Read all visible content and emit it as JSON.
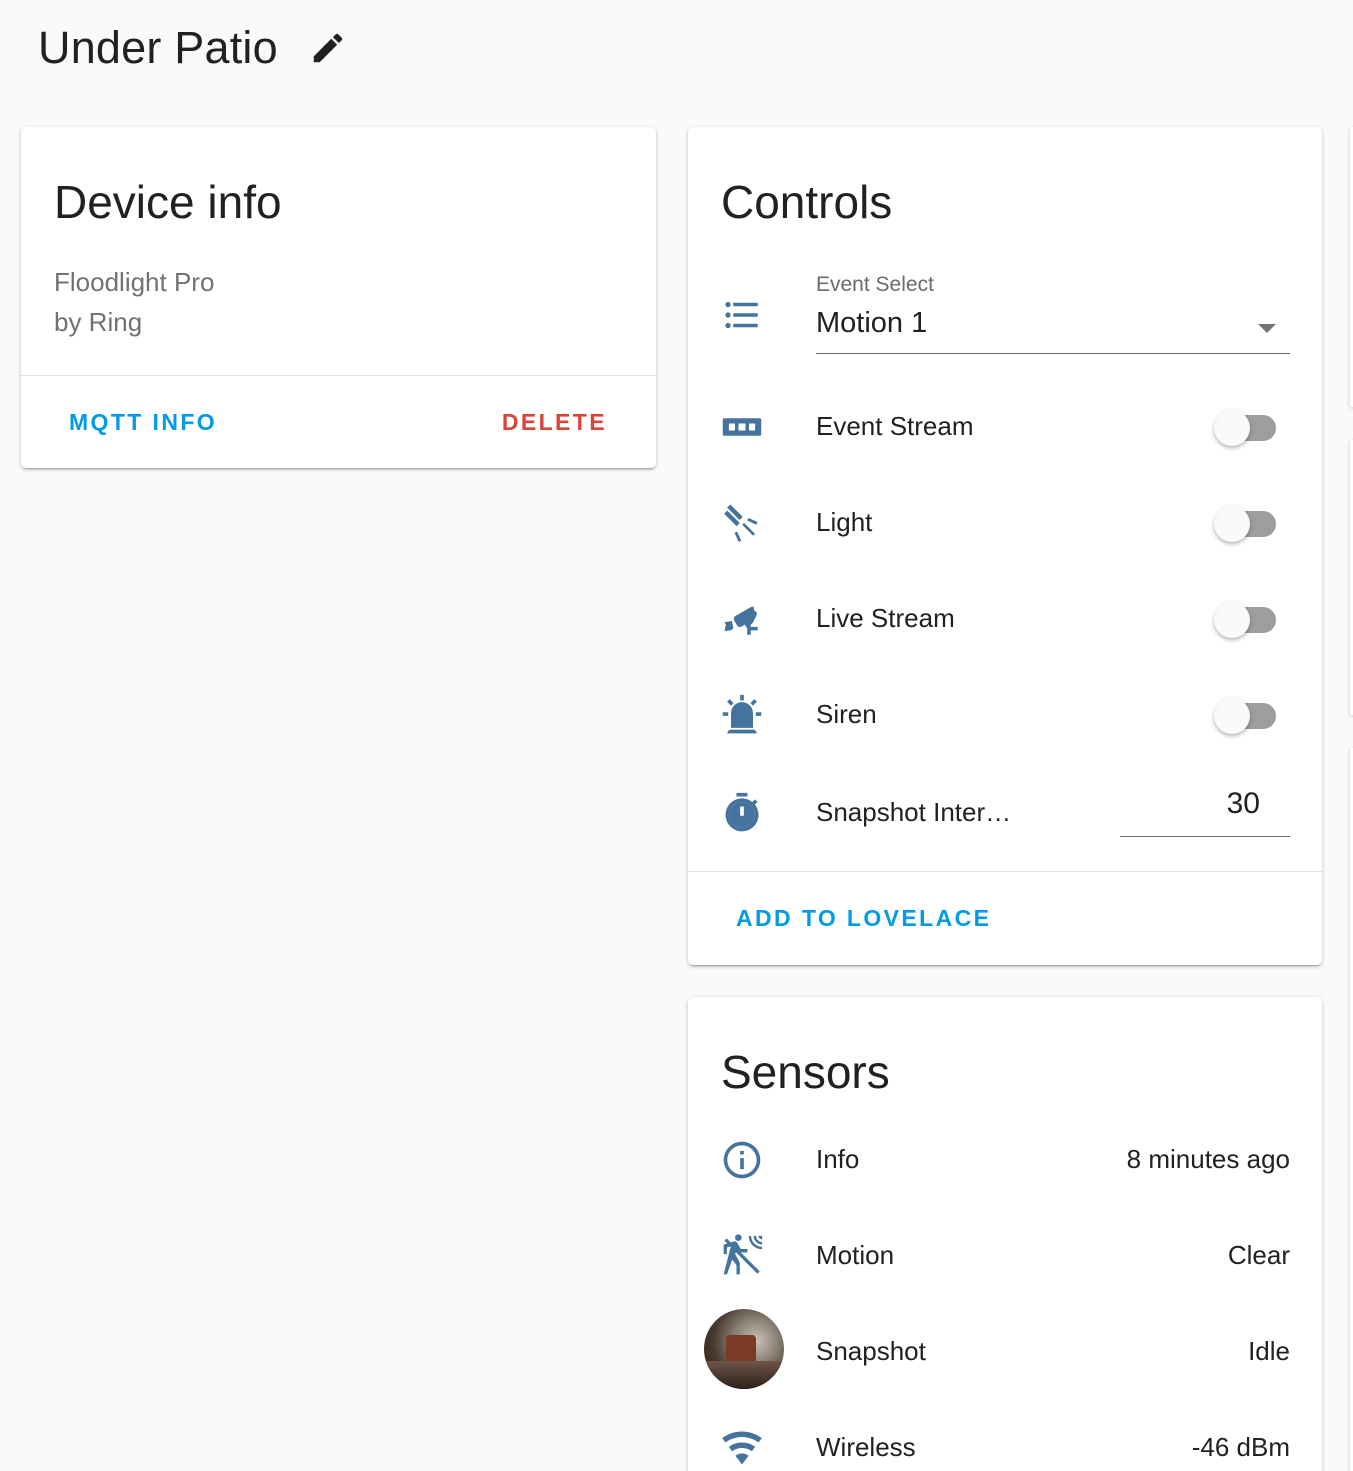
{
  "page": {
    "title": "Under Patio"
  },
  "device_info": {
    "title": "Device info",
    "model": "Floodlight Pro",
    "manufacturer": "by Ring",
    "mqtt_label": "MQTT INFO",
    "delete_label": "DELETE"
  },
  "controls": {
    "title": "Controls",
    "event_select": {
      "label": "Event Select",
      "value": "Motion 1"
    },
    "event_stream": {
      "label": "Event Stream",
      "on": false
    },
    "light": {
      "label": "Light",
      "on": false
    },
    "live_stream": {
      "label": "Live Stream",
      "on": false
    },
    "siren": {
      "label": "Siren",
      "on": false
    },
    "snapshot_interval": {
      "label": "Snapshot Inter…",
      "value": "30"
    },
    "add_label": "ADD TO LOVELACE"
  },
  "sensors": {
    "title": "Sensors",
    "info": {
      "label": "Info",
      "value": "8 minutes ago"
    },
    "motion": {
      "label": "Motion",
      "value": "Clear"
    },
    "snapshot": {
      "label": "Snapshot",
      "value": "Idle"
    },
    "wireless": {
      "label": "Wireless",
      "value": "-46 dBm"
    }
  },
  "colors": {
    "icon": "#44739e",
    "primary": "#03a9f4",
    "danger": "#db4437"
  },
  "icons": [
    "pencil-icon",
    "format-list-bulleted-icon",
    "video-input-component-icon",
    "floodlight-icon",
    "cctv-icon",
    "alarm-light-icon",
    "timer-icon",
    "information-outline-icon",
    "motion-sensor-icon",
    "wifi-icon"
  ]
}
